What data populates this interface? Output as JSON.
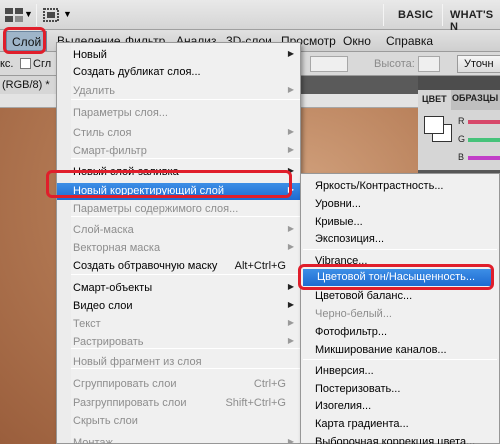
{
  "app_bar": {
    "workspace_basic": "BASIC",
    "workspace_whats_new": "WHAT'S N"
  },
  "menu_bar": {
    "items": [
      "Слой",
      "Выделение",
      "Фильтр",
      "Анализ",
      "3D-слои",
      "Просмотр",
      "Окно",
      "Справка"
    ]
  },
  "options_bar": {
    "left_label": "кс.",
    "checkbox_label": "Сгл",
    "height_label": "Высота:",
    "refine_button": "Уточн"
  },
  "document": {
    "tab_label": "(RGB/8) *"
  },
  "color_panel": {
    "tab_color": "ЦВЕТ",
    "tab_swatches": "ОБРАЗЦЫ",
    "channels": [
      "R",
      "G",
      "B"
    ],
    "channel_colors": [
      "#d7486a",
      "#46c27a",
      "#c13ec7"
    ]
  },
  "layer_menu": {
    "items": [
      {
        "label": "Новый",
        "shortcut": "",
        "submenu": true,
        "disabled": false
      },
      {
        "label": "Создать дубликат слоя...",
        "shortcut": "",
        "submenu": false,
        "disabled": false
      },
      {
        "label": "Удалить",
        "shortcut": "",
        "submenu": true,
        "disabled": true
      },
      {
        "label": "Параметры слоя...",
        "shortcut": "",
        "submenu": false,
        "disabled": true
      },
      {
        "label": "Стиль слоя",
        "shortcut": "",
        "submenu": true,
        "disabled": true
      },
      {
        "label": "Смарт-фильтр",
        "shortcut": "",
        "submenu": true,
        "disabled": true
      },
      {
        "label": "Новый слой-заливка",
        "shortcut": "",
        "submenu": true,
        "disabled": false
      },
      {
        "label": "Новый корректирующий слой",
        "shortcut": "",
        "submenu": true,
        "disabled": false,
        "highlighted": true
      },
      {
        "label": "Параметры содержимого слоя...",
        "shortcut": "",
        "submenu": false,
        "disabled": true
      },
      {
        "label": "Слой-маска",
        "shortcut": "",
        "submenu": true,
        "disabled": true
      },
      {
        "label": "Векторная маска",
        "shortcut": "",
        "submenu": true,
        "disabled": true
      },
      {
        "label": "Создать обтравочную маску",
        "shortcut": "Alt+Ctrl+G",
        "submenu": false,
        "disabled": false
      },
      {
        "label": "Смарт-объекты",
        "shortcut": "",
        "submenu": true,
        "disabled": false
      },
      {
        "label": "Видео слои",
        "shortcut": "",
        "submenu": true,
        "disabled": false
      },
      {
        "label": "Текст",
        "shortcut": "",
        "submenu": true,
        "disabled": true
      },
      {
        "label": "Растрировать",
        "shortcut": "",
        "submenu": true,
        "disabled": true
      },
      {
        "label": "Новый фрагмент из слоя",
        "shortcut": "",
        "submenu": false,
        "disabled": true
      },
      {
        "label": "Сгруппировать слои",
        "shortcut": "Ctrl+G",
        "submenu": false,
        "disabled": true
      },
      {
        "label": "Разгруппировать слои",
        "shortcut": "Shift+Ctrl+G",
        "submenu": false,
        "disabled": true
      },
      {
        "label": "Скрыть слои",
        "shortcut": "",
        "submenu": false,
        "disabled": true
      },
      {
        "label": "Монтаж",
        "shortcut": "",
        "submenu": true,
        "disabled": true
      }
    ]
  },
  "adjustment_submenu": {
    "items": [
      {
        "label": "Яркость/Контрастность...",
        "disabled": false
      },
      {
        "label": "Уровни...",
        "disabled": false
      },
      {
        "label": "Кривые...",
        "disabled": false
      },
      {
        "label": "Экспозиция...",
        "disabled": false
      },
      {
        "label": "Vibrance...",
        "disabled": false
      },
      {
        "label": "Цветовой тон/Насыщенность...",
        "disabled": false,
        "highlighted": true
      },
      {
        "label": "Цветовой баланс...",
        "disabled": false
      },
      {
        "label": "Черно-белый...",
        "disabled": true
      },
      {
        "label": "Фотофильтр...",
        "disabled": false
      },
      {
        "label": "Микширование каналов...",
        "disabled": false
      },
      {
        "label": "Инверсия...",
        "disabled": false
      },
      {
        "label": "Постеризовать...",
        "disabled": false
      },
      {
        "label": "Изогелия...",
        "disabled": false
      },
      {
        "label": "Карта градиента...",
        "disabled": false
      },
      {
        "label": "Выборочная коррекция цвета...",
        "disabled": false
      }
    ]
  }
}
